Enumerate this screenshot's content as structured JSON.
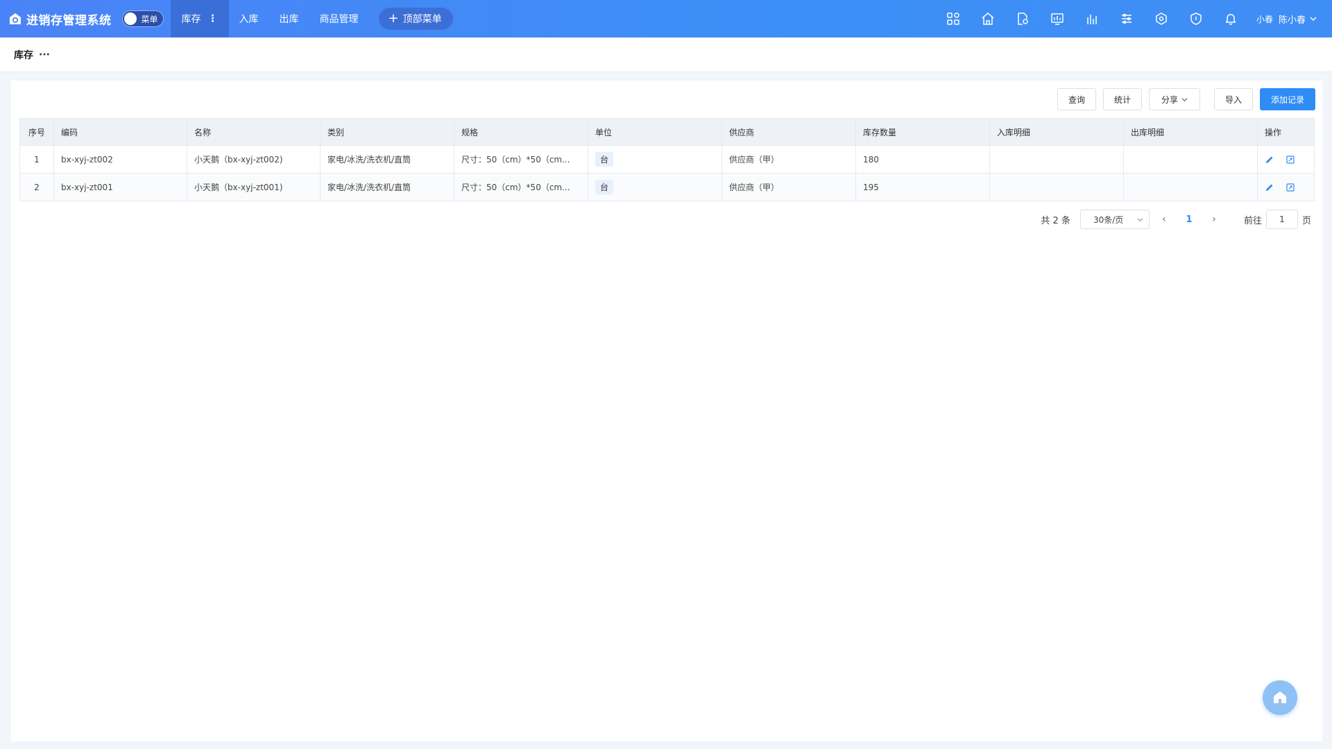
{
  "header": {
    "app_title": "进销存管理系统",
    "toggle_label": "菜单",
    "nav": [
      {
        "label": "库存",
        "active": true
      },
      {
        "label": "入库"
      },
      {
        "label": "出库"
      },
      {
        "label": "商品管理"
      }
    ],
    "top_menu_label": "顶部菜单",
    "icons": [
      "apps-icon",
      "home-icon",
      "document-settings-icon",
      "dashboard-icon",
      "chart-icon",
      "data-icon",
      "network-icon",
      "shield-icon",
      "bell-icon"
    ],
    "user_nickname": "小春",
    "user_name": "陈小春"
  },
  "breadcrumb": {
    "title": "库存",
    "more": "···"
  },
  "toolbar": {
    "query": "查询",
    "stats": "统计",
    "share": "分享",
    "import": "导入",
    "add": "添加记录"
  },
  "table": {
    "columns": [
      "序号",
      "编码",
      "名称",
      "类别",
      "规格",
      "单位",
      "供应商",
      "库存数量",
      "入库明细",
      "出库明细",
      "操作"
    ],
    "rows": [
      {
        "idx": "1",
        "code": "bx-xyj-zt002",
        "name": "小天鹅（bx-xyj-zt002)",
        "category": "家电/冰洗/洗衣机/直筒",
        "spec": "尺寸：50（cm）*50（cm...",
        "unit": "台",
        "supplier": "供应商（甲）",
        "qty": "180",
        "in_detail": "",
        "out_detail": ""
      },
      {
        "idx": "2",
        "code": "bx-xyj-zt001",
        "name": "小天鹅（bx-xyj-zt001)",
        "category": "家电/冰洗/洗衣机/直筒",
        "spec": "尺寸：50（cm）*50（cm...",
        "unit": "台",
        "supplier": "供应商（甲）",
        "qty": "195",
        "in_detail": "",
        "out_detail": ""
      }
    ]
  },
  "pager": {
    "total": "共 2 条",
    "page_size": "30条/页",
    "current_page": "1",
    "goto_label": "前往",
    "goto_value": "1",
    "page_suffix": "页"
  },
  "colors": {
    "primary": "#2f8cf5",
    "topbar": "#4a83f7"
  }
}
